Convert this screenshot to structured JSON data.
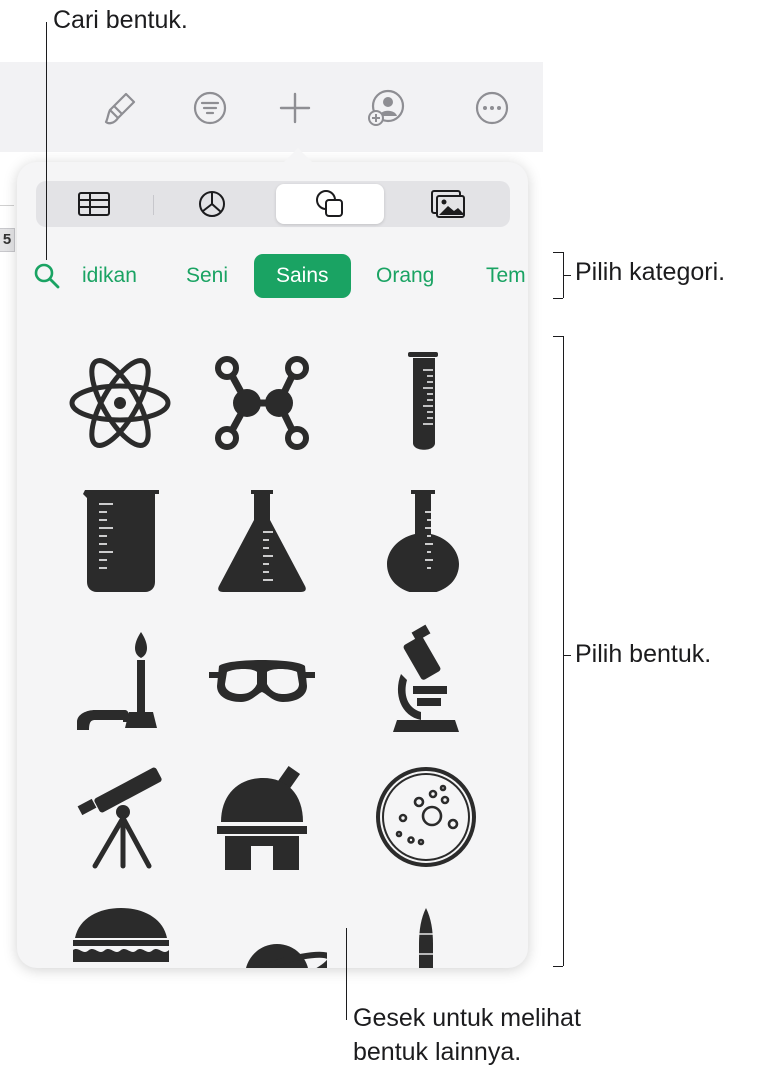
{
  "callouts": {
    "search": "Cari bentuk.",
    "category": "Pilih kategori.",
    "shapes": "Pilih bentuk.",
    "swipe_line1": "Gesek untuk melihat",
    "swipe_line2": "bentuk lainnya."
  },
  "toolbar": {
    "icons": [
      "paintbrush-icon",
      "filter-icon",
      "plus-icon",
      "collaborate-icon",
      "more-icon"
    ]
  },
  "document": {
    "row_number": "5"
  },
  "popover": {
    "tabs": [
      {
        "icon": "table-icon",
        "active": false
      },
      {
        "icon": "chart-icon",
        "active": false
      },
      {
        "icon": "shapes-icon",
        "active": true
      },
      {
        "icon": "media-icon",
        "active": false
      }
    ],
    "categories": [
      {
        "label": "idikan",
        "active": false
      },
      {
        "label": "Seni",
        "active": false
      },
      {
        "label": "Sains",
        "active": true
      },
      {
        "label": "Orang",
        "active": false
      },
      {
        "label": "Tem",
        "active": false
      }
    ],
    "shapes": [
      "atom-shape",
      "molecule-shape",
      "test-tube-shape",
      "beaker-shape",
      "erlenmeyer-flask-shape",
      "round-flask-shape",
      "bunsen-burner-shape",
      "safety-goggles-shape",
      "microscope-shape",
      "telescope-shape",
      "observatory-shape",
      "petri-dish-shape",
      "dome-shape",
      "saturn-shape",
      "rocket-shape"
    ]
  },
  "colors": {
    "accent": "#1aa363",
    "icon": "#2b2b2b",
    "toolbar_icon": "#8e8e93"
  }
}
